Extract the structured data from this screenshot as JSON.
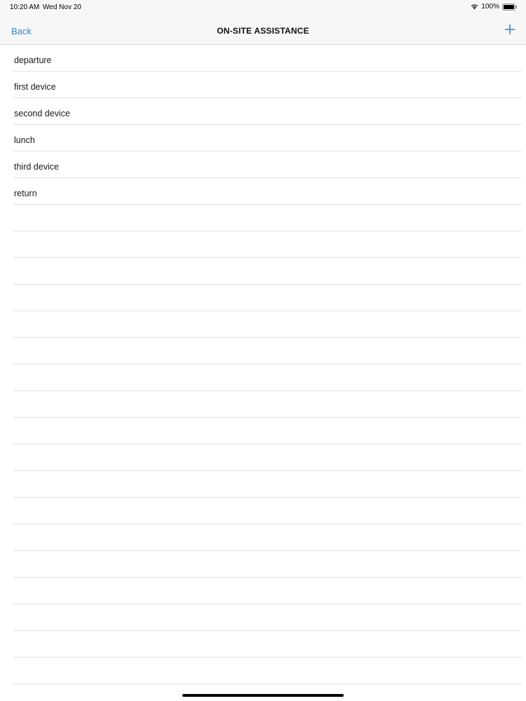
{
  "status_bar": {
    "time": "10:20 AM",
    "date": "Wed Nov 20",
    "battery": "100%",
    "battery_level": 1.0
  },
  "nav_bar": {
    "back_label": "Back",
    "title": "ON-SITE ASSISTANCE",
    "add_icon": "plus-icon"
  },
  "list": {
    "items": [
      {
        "label": "departure"
      },
      {
        "label": "first device"
      },
      {
        "label": "second device"
      },
      {
        "label": "lunch"
      },
      {
        "label": "third device"
      },
      {
        "label": "return"
      },
      {
        "label": ""
      },
      {
        "label": ""
      },
      {
        "label": ""
      },
      {
        "label": ""
      },
      {
        "label": ""
      },
      {
        "label": ""
      },
      {
        "label": ""
      },
      {
        "label": ""
      },
      {
        "label": ""
      },
      {
        "label": ""
      },
      {
        "label": ""
      },
      {
        "label": ""
      },
      {
        "label": ""
      },
      {
        "label": ""
      },
      {
        "label": ""
      },
      {
        "label": ""
      },
      {
        "label": ""
      },
      {
        "label": ""
      },
      {
        "label": ""
      }
    ]
  },
  "colors": {
    "accent": "#2f86d6",
    "nav_background": "#f7f7f7",
    "separator": "#e1e1e1"
  }
}
